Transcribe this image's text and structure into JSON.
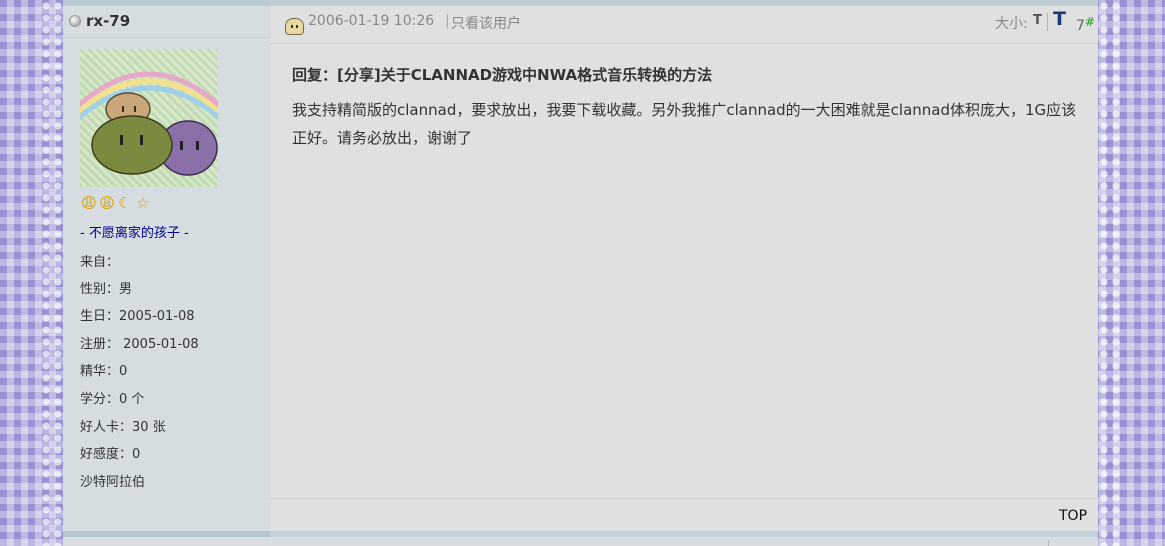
{
  "user": {
    "name": "rx-79",
    "ranks": [
      "😩",
      "😩",
      "☾",
      "☆"
    ],
    "title": "- 不愿离家的孩子 -",
    "info": [
      "来自：",
      "性别：男",
      "生日：2005-01-08",
      "注册： 2005-01-08",
      "精华：0",
      "学分：0 个",
      "好人卡：30 张",
      "好感度：0",
      "沙特阿拉伯"
    ]
  },
  "post": {
    "time": "2006-01-19 10:26",
    "sep": "|",
    "only_user": "只看该用户",
    "size_label": "大小:",
    "size_small": "T",
    "size_large": "T",
    "floor_num": "7",
    "floor_mark": "#",
    "title": "回复：[分享]关于CLANNAD游戏中NWA格式音乐转换的方法",
    "body": "我支持精简版的clannad，要求放出，我要下载收藏。另外我推广clannad的一大困难就是clannad体积庞大，1G应该正好。请务必放出，谢谢了",
    "top_link": "TOP"
  },
  "colors": {
    "page_bg": "#a9a4d6",
    "sidebar_bg": "#d6dde1",
    "post_bg": "#e0e0e0",
    "title_blue": "#000088",
    "floor_green": "#1a9a1a"
  }
}
